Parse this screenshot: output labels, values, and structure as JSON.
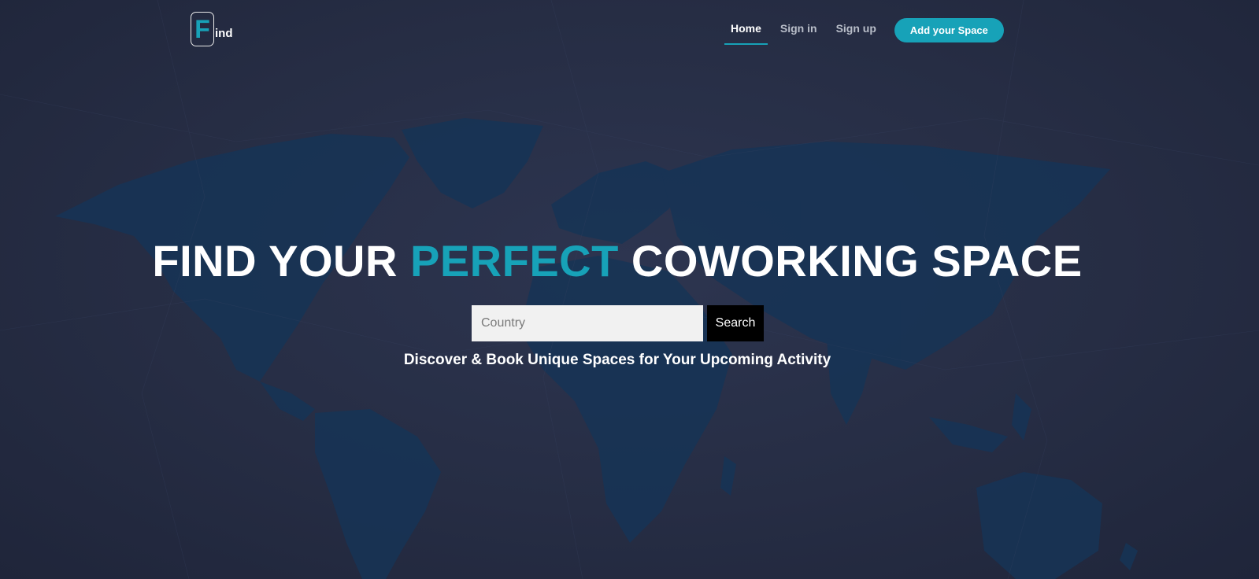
{
  "brand": {
    "logo_letter": "F",
    "logo_rest": "ind",
    "accent_color": "#17a2b8"
  },
  "nav": {
    "items": [
      {
        "label": "Home",
        "active": true
      },
      {
        "label": "Sign in",
        "active": false
      },
      {
        "label": "Sign up",
        "active": false
      }
    ],
    "cta_label": "Add your Space"
  },
  "hero": {
    "headline_part1": "FIND YOUR",
    "headline_accent": "PERFECT",
    "headline_part2": "COWORKING SPACE",
    "search_placeholder": "Country",
    "search_value": "",
    "search_button_label": "Search",
    "tagline": "Discover & Book Unique Spaces for Your Upcoming Activity",
    "background": "world-map"
  }
}
